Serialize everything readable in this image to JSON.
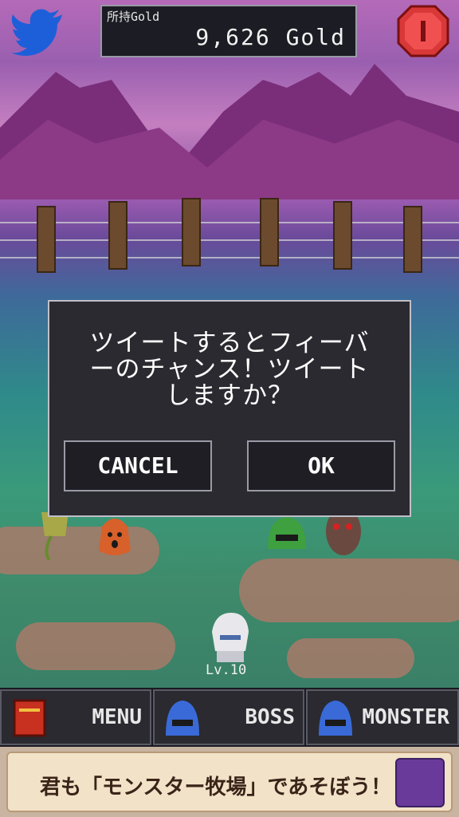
{
  "header": {
    "gold_label": "所持Gold",
    "gold_value": "9,626 Gold"
  },
  "icons": {
    "twitter": "twitter-bird-icon",
    "gem": "red-gem-icon"
  },
  "dialog": {
    "message": "ツイートするとフィーバ\nーのチャンス！ツイート\nしますか？",
    "cancel_label": "CANCEL",
    "ok_label": "OK"
  },
  "player": {
    "level": "Lv.10"
  },
  "tabs": [
    {
      "label": "MENU",
      "icon": "book-icon"
    },
    {
      "label": "BOSS",
      "icon": "blue-slime-icon"
    },
    {
      "label": "MONSTER",
      "icon": "blue-slime-icon"
    }
  ],
  "ad": {
    "text": "君も「モンスター牧場」であそぼう！"
  },
  "colors": {
    "dialog_bg": "#2a2a30",
    "dialog_border": "#bfbfc8",
    "twitter_blue": "#1d5fd8",
    "gem_red": "#d83838"
  }
}
